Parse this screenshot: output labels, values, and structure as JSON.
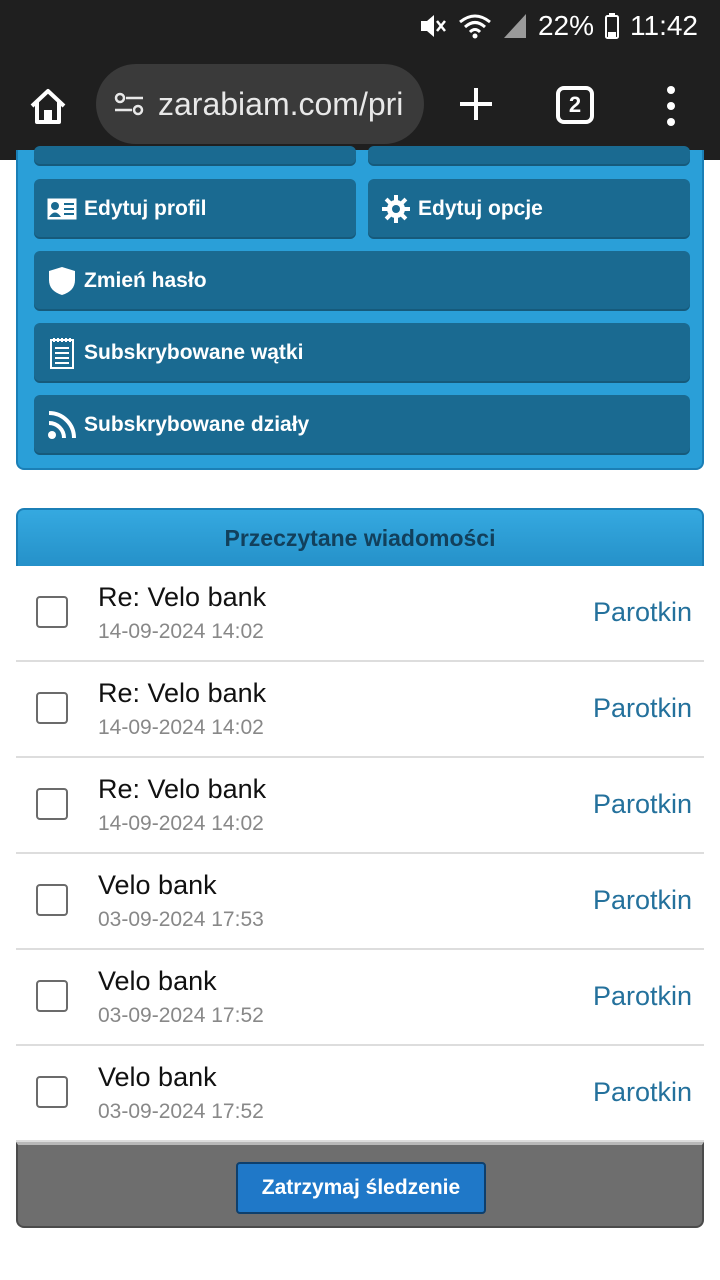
{
  "status_bar": {
    "battery": "22%",
    "time": "11:42"
  },
  "browser": {
    "url": "zarabiam.com/pri",
    "tab_count": "2"
  },
  "profile_menu": {
    "edit_profile": "Edytuj profil",
    "edit_options": "Edytuj opcje",
    "change_password": "Zmień hasło",
    "subscribed_threads": "Subskrybowane wątki",
    "subscribed_sections": "Subskrybowane działy"
  },
  "messages": {
    "header": "Przeczytane wiadomości",
    "rows": [
      {
        "title": "Re: Velo bank",
        "date": "14-09-2024 14:02",
        "author": "Parotkin"
      },
      {
        "title": "Re: Velo bank",
        "date": "14-09-2024 14:02",
        "author": "Parotkin"
      },
      {
        "title": "Re: Velo bank",
        "date": "14-09-2024 14:02",
        "author": "Parotkin"
      },
      {
        "title": "Velo bank",
        "date": "03-09-2024 17:53",
        "author": "Parotkin"
      },
      {
        "title": "Velo bank",
        "date": "03-09-2024 17:52",
        "author": "Parotkin"
      },
      {
        "title": "Velo bank",
        "date": "03-09-2024 17:52",
        "author": "Parotkin"
      }
    ],
    "stop_button": "Zatrzymaj śledzenie"
  }
}
